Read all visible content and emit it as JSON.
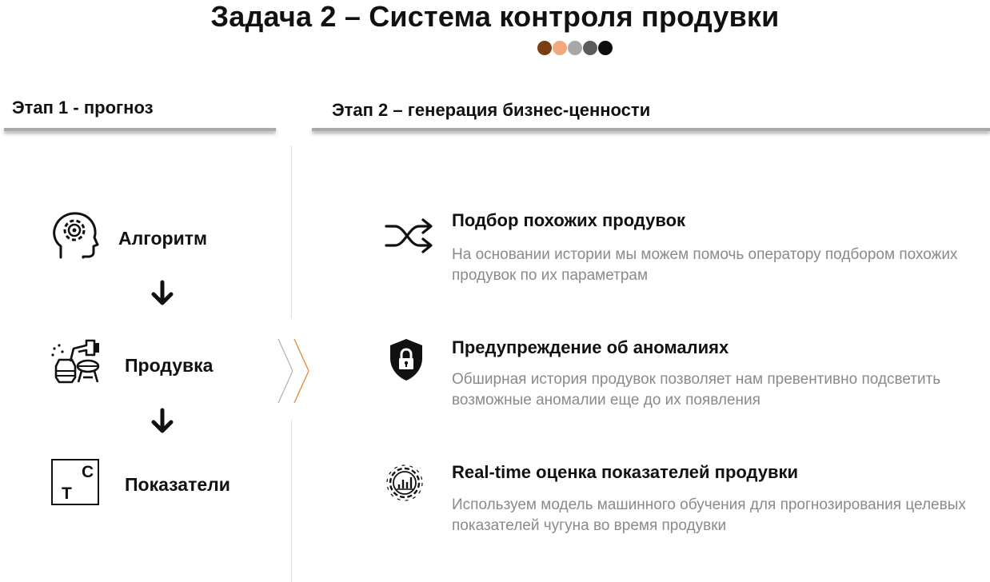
{
  "header": {
    "title": "Задача 2 – Система контроля продувки",
    "dot_colors": [
      "#7a3e12",
      "#f2a97c",
      "#a8a8a8",
      "#5c5c5c",
      "#0d0d0d"
    ]
  },
  "stage1": {
    "label": "Этап 1 - прогноз",
    "steps": [
      {
        "label": "Алгоритм",
        "icon": "head-gear-icon"
      },
      {
        "label": "Продувка",
        "icon": "converter-icon"
      },
      {
        "label": "Показатели",
        "icon": "tc-indicators-icon",
        "icon_letters": [
          "C",
          "T"
        ]
      }
    ]
  },
  "stage2": {
    "label": "Этап 2 – генерация бизнес-ценности",
    "features": [
      {
        "title": "Подбор похожих продувок",
        "desc": "На основании истории мы можем помочь оператору подбором похожих продувок по их параметрам",
        "icon": "shuffle-arrows-icon"
      },
      {
        "title": "Предупреждение об аномалиях",
        "desc": "Обширная история продувок позволяет нам превентивно подсветить возможные аномалии еще до их появления",
        "icon": "shield-lock-icon"
      },
      {
        "title": "Real-time оценка показателей продувки",
        "desc": "Используем модель машинного обучения для прогнозирования целевых показателей чугуна во время продувки",
        "icon": "gear-chart-icon"
      }
    ]
  },
  "colors": {
    "chevron_gray": "#b5b5b5",
    "chevron_orange": "#e08a3c",
    "rule_gray": "#a9a9a9"
  }
}
